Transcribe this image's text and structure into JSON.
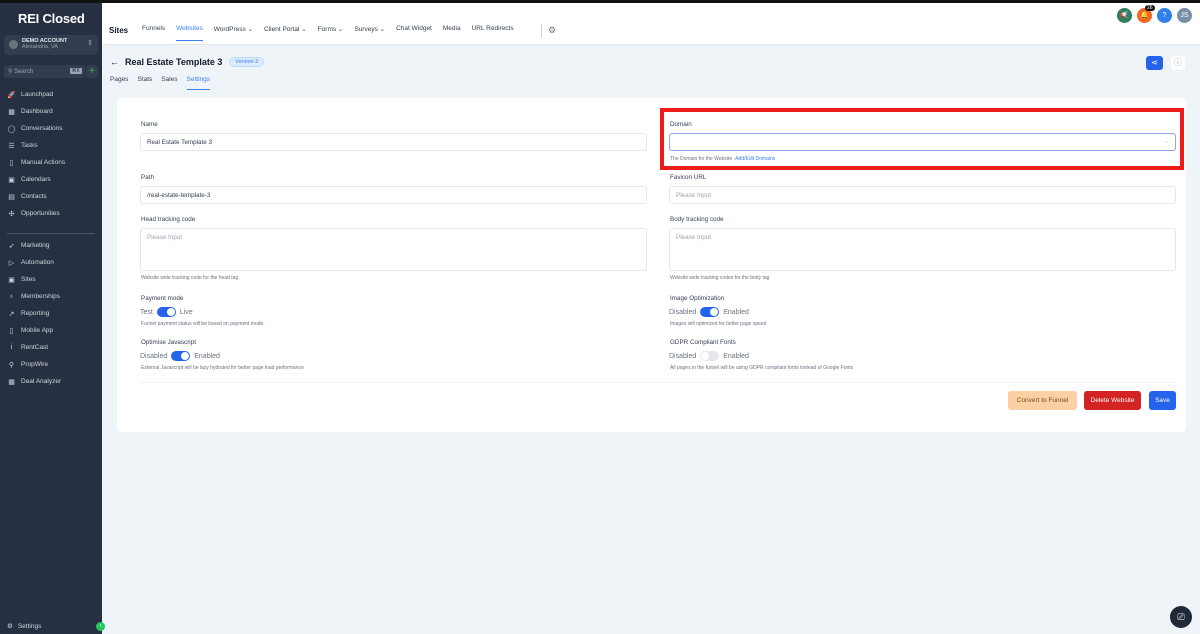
{
  "app": {
    "logo": "REI Closed",
    "account_name": "DEMO ACCOUNT",
    "account_location": "Alexandria, VA",
    "search_placeholder": "Search",
    "search_shortcut": "⌘K"
  },
  "sidebar": {
    "items": [
      {
        "label": "Launchpad",
        "icon": "🚀"
      },
      {
        "label": "Dashboard",
        "icon": "▦"
      },
      {
        "label": "Conversations",
        "icon": "◯"
      },
      {
        "label": "Tasks",
        "icon": "☰"
      },
      {
        "label": "Manual Actions",
        "icon": "▯"
      },
      {
        "label": "Calendars",
        "icon": "▣"
      },
      {
        "label": "Contacts",
        "icon": "▤"
      },
      {
        "label": "Opportunities",
        "icon": "✣"
      }
    ],
    "items2": [
      {
        "label": "Marketing",
        "icon": "➶"
      },
      {
        "label": "Automation",
        "icon": "▷"
      },
      {
        "label": "Sites",
        "icon": "▣"
      },
      {
        "label": "Memberships",
        "icon": "♁"
      },
      {
        "label": "Reporting",
        "icon": "↗"
      },
      {
        "label": "Mobile App",
        "icon": "▯"
      },
      {
        "label": "RentCast",
        "icon": "i"
      },
      {
        "label": "PropWire",
        "icon": "⚲"
      },
      {
        "label": "Deal Analyzer",
        "icon": "▦"
      }
    ],
    "settings": "Settings"
  },
  "topbar": {
    "title": "Sites",
    "tabs": [
      "Funnels",
      "Websites",
      "WordPress ⌄",
      "Client Portal ⌄",
      "Forms ⌄",
      "Surveys ⌄",
      "Chat Widget",
      "Media",
      "URL Redirects"
    ],
    "active_tab": "Websites",
    "notification_count": "26",
    "avatar": "JS",
    "help": "?"
  },
  "page": {
    "title": "Real Estate Template 3",
    "version": "Version 2",
    "subtabs": [
      "Pages",
      "Stats",
      "Sales",
      "Settings"
    ],
    "active_subtab": "Settings"
  },
  "form": {
    "name_label": "Name",
    "name_value": "Real Estate Template 3",
    "domain_label": "Domain",
    "domain_value": "",
    "domain_help": "The Domain for the Website -",
    "domain_link": "Add/Edit Domains",
    "path_label": "Path",
    "path_value": "/real-estate-template-3",
    "favicon_label": "Favicon URL",
    "favicon_placeholder": "Please Input",
    "head_label": "Head tracking code",
    "head_placeholder": "Please Input",
    "head_help": "Website wide tracking code for the head tag",
    "body_label": "Body tracking code",
    "body_placeholder": "Please Input",
    "body_help": "Website wide tracking codes for the body tag",
    "payment_label": "Payment mode",
    "payment_off": "Test",
    "payment_on": "Live",
    "payment_enabled": true,
    "payment_help": "Funnel payment status will be based on payment mode.",
    "imgopt_label": "Image Optimization",
    "imgopt_off": "Disabled",
    "imgopt_on": "Enabled",
    "imgopt_enabled": true,
    "imgopt_help": "Images will optimized for better page speed",
    "js_label": "Optimise Javascript",
    "js_off": "Disabled",
    "js_on": "Enabled",
    "js_enabled": true,
    "js_help": "External Javascript will be lazy hydrated for better page load performance",
    "gdpr_label": "GDPR Compliant Fonts",
    "gdpr_off": "Disabled",
    "gdpr_on": "Enabled",
    "gdpr_enabled": false,
    "gdpr_help": "All pages in the funnel will be using GDPR compliant fonts instead of Google Fonts"
  },
  "actions": {
    "convert": "Convert to Funnel",
    "delete": "Delete Website",
    "save": "Save"
  },
  "colors": {
    "primary": "#2563eb",
    "danger": "#d32424",
    "warning_bg": "#fbd0a2",
    "highlight": "#ef1c1c"
  }
}
